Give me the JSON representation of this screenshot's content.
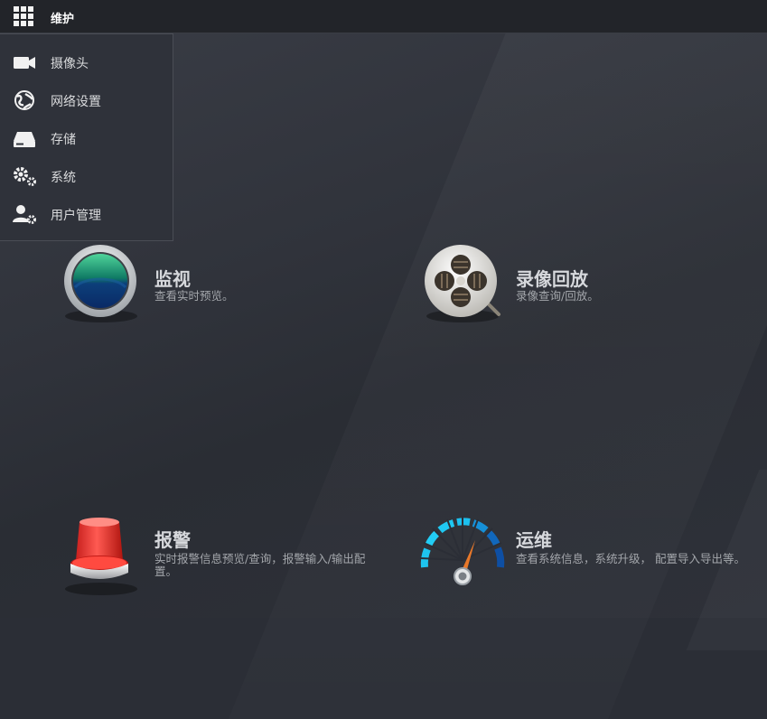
{
  "topbar": {
    "title": "维护"
  },
  "menu": {
    "items": [
      {
        "label": "摄像头",
        "icon": "camera-icon"
      },
      {
        "label": "网络设置",
        "icon": "network-globe-icon"
      },
      {
        "label": "存储",
        "icon": "storage-drive-icon"
      },
      {
        "label": "系统",
        "icon": "system-gears-icon"
      },
      {
        "label": "用户管理",
        "icon": "user-management-icon"
      }
    ]
  },
  "tiles": {
    "monitor": {
      "title": "监视",
      "desc": "查看实时预览。",
      "icon": "monitor-lens-icon"
    },
    "playback": {
      "title": "录像回放",
      "desc": "录像查询/回放。",
      "icon": "film-reel-icon"
    },
    "alarm": {
      "title": "报警",
      "desc": "实时报警信息预览/查询，报警输入/输出配置。",
      "icon": "alarm-siren-icon"
    },
    "maintenance": {
      "title": "运维",
      "desc": "查看系统信息，系统升级， 配置导入导出等。",
      "icon": "gauge-meter-icon"
    }
  },
  "colors": {
    "background": "#2f323a",
    "topbar": "#222429",
    "menu_text": "#d9dadc",
    "tile_title": "#d6d8dc",
    "tile_desc": "#a3a6ab"
  }
}
